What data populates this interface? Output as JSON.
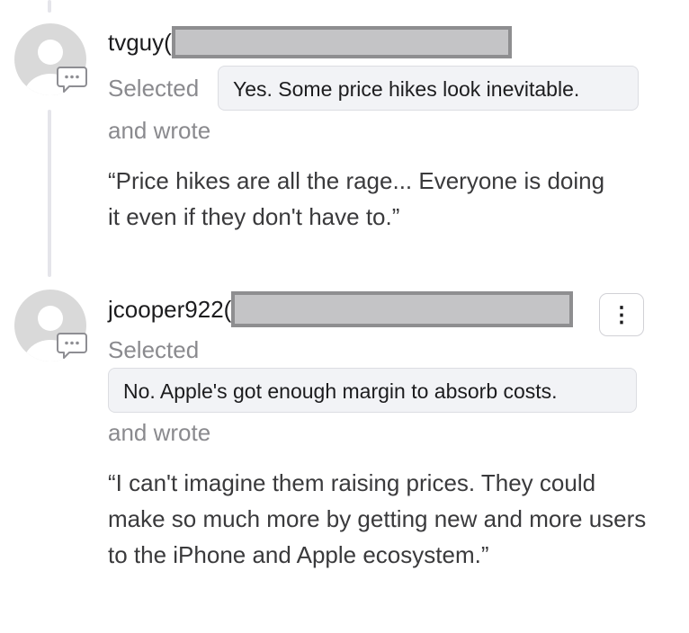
{
  "colors": {
    "avatar_bg": "#d9d9d9",
    "avatar_figure": "#ffffff",
    "thread_line": "#e5e5ea",
    "redaction_fill": "#c4c4c6",
    "redaction_border": "#8e8e90"
  },
  "comments": [
    {
      "username": "tvguy(",
      "selected_label": "Selected",
      "choice": "Yes. Some price hikes look inevitable.",
      "wrote_label": "and wrote",
      "quote": "“Price hikes are all the rage... Everyone is doing it even if they don't have to.”",
      "avatar_icon": "default-avatar-icon",
      "badge_icon": "speech-bubble-icon"
    },
    {
      "username": "jcooper922(",
      "selected_label": "Selected",
      "choice": "No. Apple's got enough margin to absorb costs.",
      "wrote_label": "and wrote",
      "quote": "“I can't imagine them raising prices. They could make so much more by getting new and more users to the iPhone and Apple ecosystem.”",
      "avatar_icon": "default-avatar-icon",
      "badge_icon": "speech-bubble-icon",
      "more_icon": "more-options-icon",
      "more_glyph": "⋮"
    }
  ]
}
